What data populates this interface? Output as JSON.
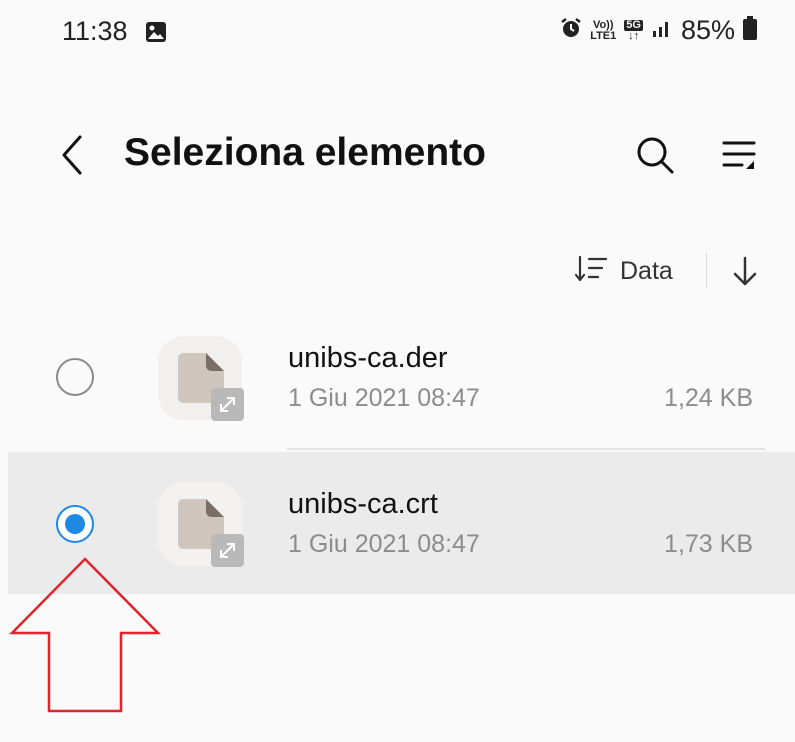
{
  "status_bar": {
    "time": "11:38",
    "battery_percent": "85%",
    "icons": [
      "image-icon",
      "alarm-icon",
      "volte-icon",
      "5g-icon",
      "signal-icon",
      "battery-icon"
    ],
    "volte_top": "Vo))",
    "volte_bottom": "LTE1",
    "network": "5G"
  },
  "header": {
    "title": "Seleziona elemento",
    "icons": [
      "back-arrow-icon",
      "search-icon",
      "menu-icon"
    ]
  },
  "sort": {
    "label": "Data",
    "icons": [
      "sort-icon",
      "sort-direction-icon"
    ]
  },
  "files": [
    {
      "name": "unibs-ca.der",
      "date": "1 Giu 2021 08:47",
      "size": "1,24 KB",
      "selected": false
    },
    {
      "name": "unibs-ca.crt",
      "date": "1 Giu 2021 08:47",
      "size": "1,73 KB",
      "selected": true
    }
  ],
  "colors": {
    "accent": "#1e88e5",
    "annotation_arrow": "#e0242b",
    "selected_row": "#ebebeb"
  }
}
